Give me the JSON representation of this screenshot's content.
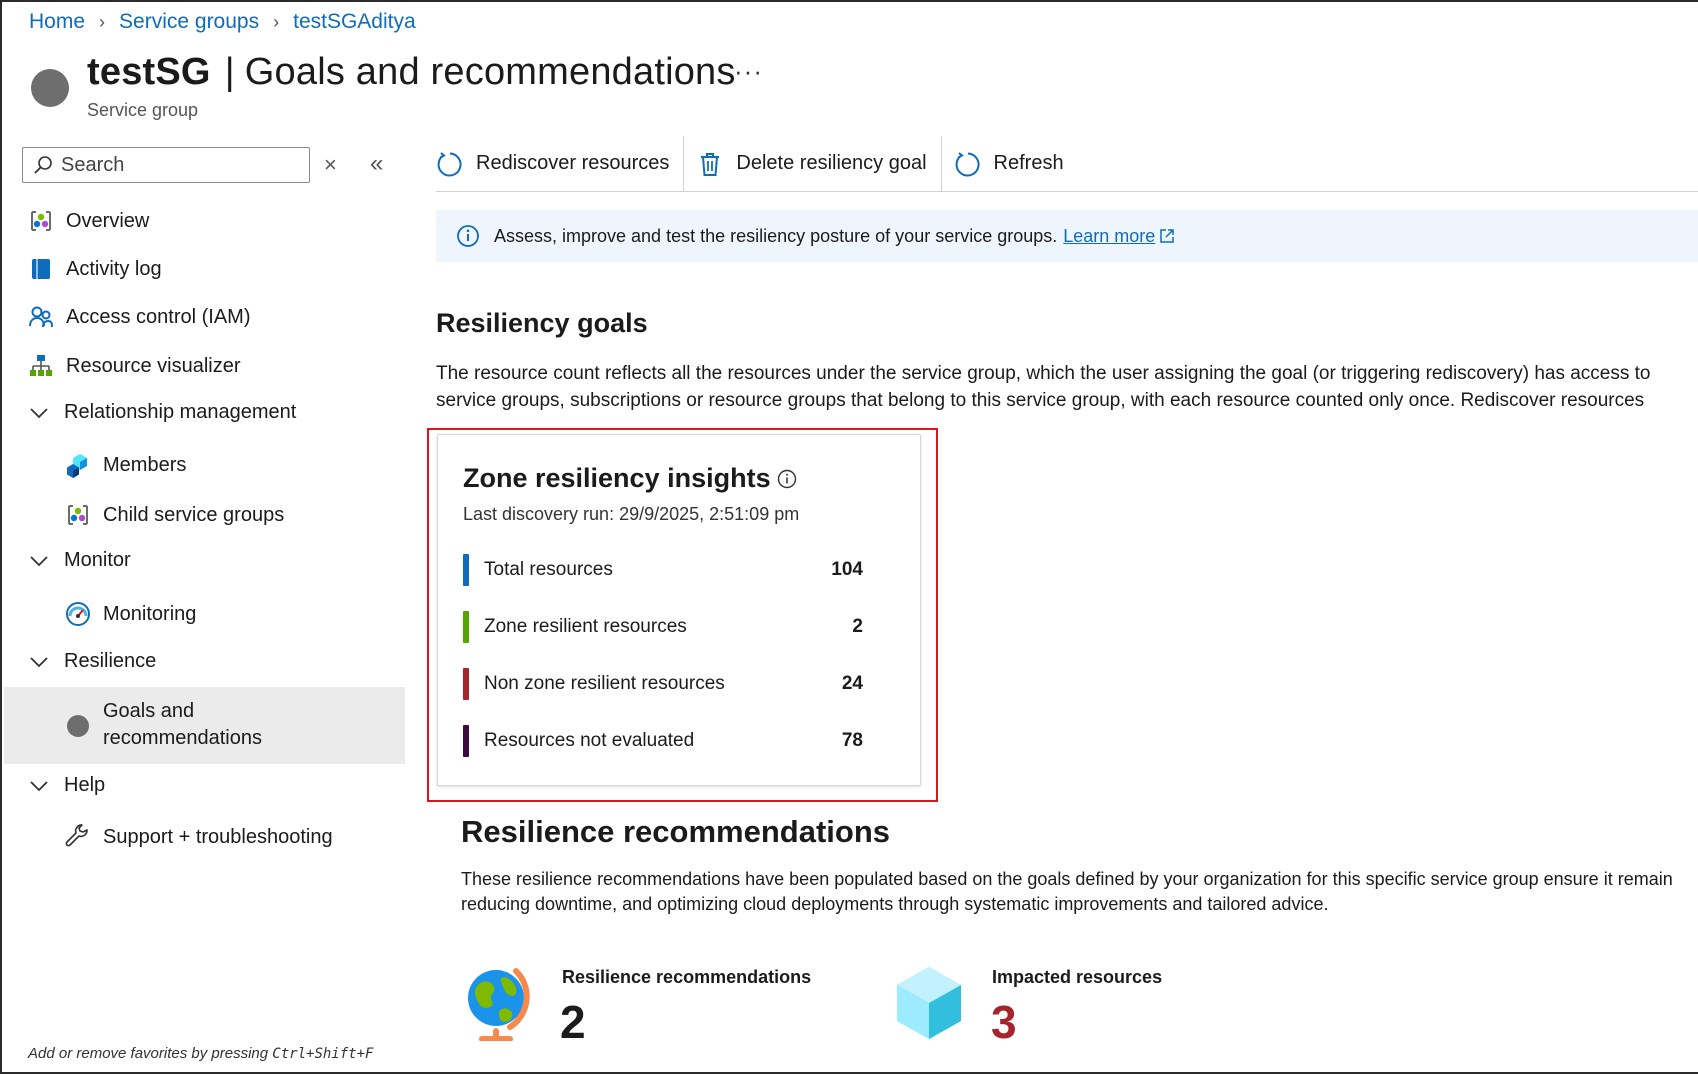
{
  "breadcrumb": [
    "Home",
    "Service groups",
    "testSGAditya"
  ],
  "title": {
    "name": "testSG",
    "separator": "|",
    "page": "Goals and recommendations",
    "more": "···",
    "subtitle": "Service group"
  },
  "sidebar": {
    "search_placeholder": "Search",
    "clear": "×",
    "collapse": "«",
    "items": {
      "overview": "Overview",
      "activity_log": "Activity log",
      "access_control": "Access control (IAM)",
      "resource_visualizer": "Resource visualizer",
      "relationship_management": "Relationship management",
      "members": "Members",
      "child_service_groups": "Child service groups",
      "monitor": "Monitor",
      "monitoring": "Monitoring",
      "resilience": "Resilience",
      "goals_line1": "Goals and",
      "goals_line2": "recommendations",
      "help": "Help",
      "support": "Support + troubleshooting"
    },
    "favorites_note": "Add or remove favorites by pressing",
    "favorites_keys": "Ctrl+Shift+F"
  },
  "toolbar": {
    "rediscover": "Rediscover resources",
    "delete_goal": "Delete resiliency goal",
    "refresh": "Refresh"
  },
  "info_bar": {
    "text": "Assess, improve and test the resiliency posture of your service groups.",
    "link": "Learn more"
  },
  "resiliency_goals": {
    "heading": "Resiliency goals",
    "line1": "The resource count reflects all the resources under the service group, which the user assigning the goal (or triggering rediscovery) has access to",
    "line2": "service groups, subscriptions or resource groups that belong to this service group, with each resource counted only once. Rediscover resources"
  },
  "insights": {
    "title": "Zone resiliency insights",
    "last_run": "Last discovery run: 29/9/2025, 2:51:09 pm",
    "metrics": [
      {
        "label": "Total resources",
        "value": "104",
        "color": "#0f6cbd"
      },
      {
        "label": "Zone resilient resources",
        "value": "2",
        "color": "#57a300"
      },
      {
        "label": "Non zone resilient resources",
        "value": "24",
        "color": "#a4262c"
      },
      {
        "label": "Resources not evaluated",
        "value": "78",
        "color": "#3b0a3f"
      }
    ]
  },
  "recommendations": {
    "heading": "Resilience recommendations",
    "line1": "These resilience recommendations have been populated based on the goals defined by your organization for this specific service group ensure it remain",
    "line2": "reducing downtime, and optimizing cloud deployments through systematic improvements and tailored advice.",
    "stats": [
      {
        "label": "Resilience recommendations",
        "value": "2",
        "color": "#1b1b1b"
      },
      {
        "label": "Impacted resources",
        "value": "3",
        "color": "#a4262c"
      }
    ]
  }
}
